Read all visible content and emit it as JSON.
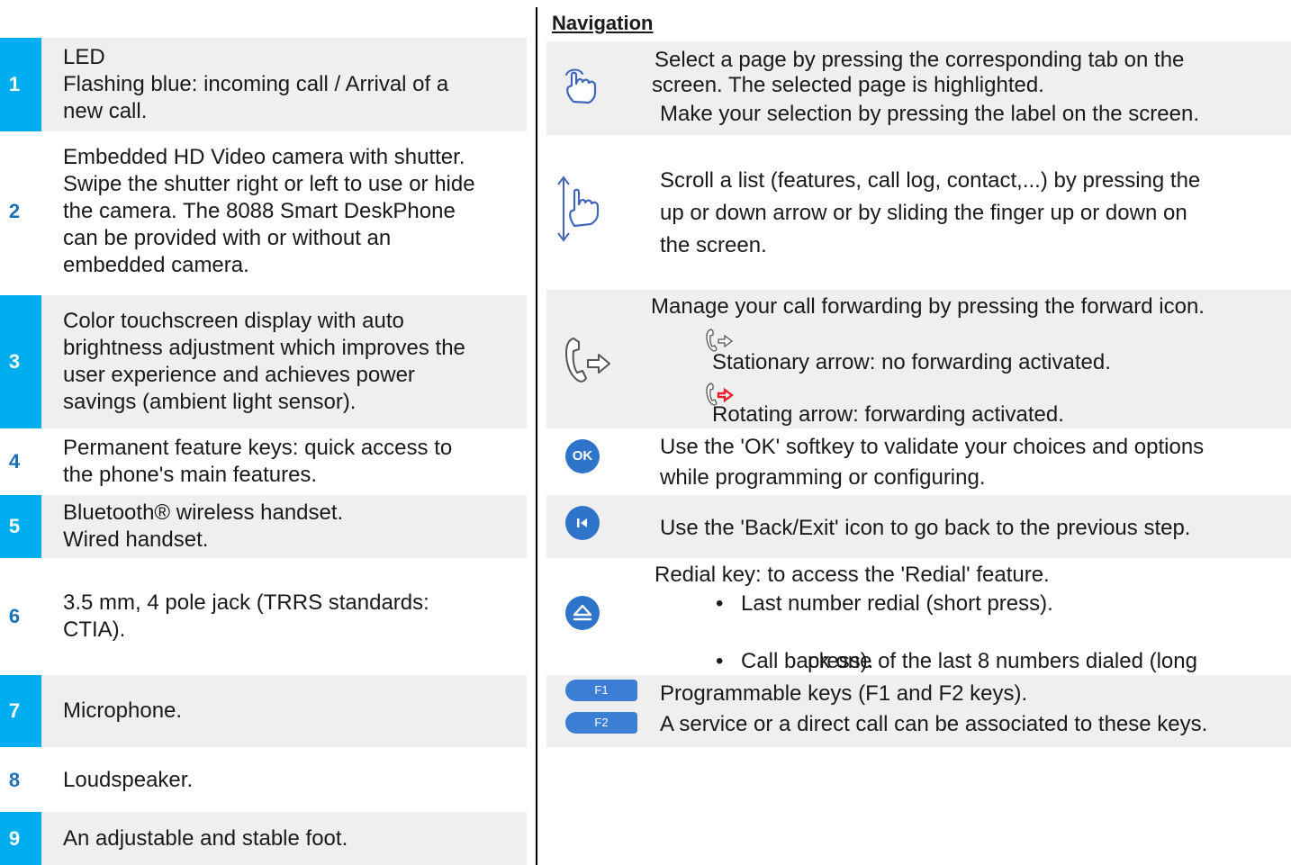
{
  "left_rows": [
    {
      "num": "1",
      "lines": [
        "LED",
        "Flashing blue: incoming call / Arrival of a",
        "new call."
      ]
    },
    {
      "num": "2",
      "lines": [
        "Embedded HD Video camera with shutter.",
        "Swipe the shutter right or left to use or hide",
        "the camera. The 8088 Smart DeskPhone",
        "can be provided with or without an",
        "embedded camera."
      ]
    },
    {
      "num": "3",
      "lines": [
        "Color touchscreen display with auto",
        "brightness adjustment which improves the",
        "user experience and achieves power",
        "savings (ambient light sensor)."
      ]
    },
    {
      "num": "4",
      "lines": [
        "Permanent feature keys: quick access to",
        "the phone's main features."
      ]
    },
    {
      "num": "5",
      "lines": [
        "Bluetooth® wireless handset.",
        "Wired handset."
      ]
    },
    {
      "num": "6",
      "lines": [
        "3.5 mm, 4 pole jack (TRRS standards:",
        "CTIA)."
      ]
    },
    {
      "num": "7",
      "lines": [
        "Microphone."
      ]
    },
    {
      "num": "8",
      "lines": [
        "Loudspeaker."
      ]
    },
    {
      "num": "9",
      "lines": [
        "An adjustable and stable foot."
      ]
    }
  ],
  "navigation": {
    "heading": "Navigation",
    "select": {
      "icon": "tap-hand-icon",
      "lines": [
        "Select a page by pressing the corresponding tab on the",
        "screen. The selected page is highlighted.",
        "Make your selection by pressing the label on the screen."
      ]
    },
    "scroll": {
      "icon": "scroll-hand-icon",
      "lines": [
        "Scroll a list (features, call log, contact,...) by pressing the",
        "up or down arrow or by sliding the finger up or down on",
        "the screen."
      ]
    },
    "forward": {
      "icon": "call-forward-icon",
      "intro": "Manage your call forwarding by pressing the forward icon.",
      "stationary": "Stationary arrow: no forwarding activated.",
      "rotating": "Rotating arrow: forwarding activated.",
      "active_color": "#e8202a"
    },
    "ok": {
      "icon_label": "OK",
      "lines": [
        "Use the 'OK' softkey to validate your choices and options",
        "while programming or configuring."
      ]
    },
    "back": {
      "icon": "back-exit-icon",
      "text": "Use the 'Back/Exit' icon to go back to the previous step."
    },
    "redial": {
      "icon": "redial-icon",
      "intro": "Redial key: to access the 'Redial' feature.",
      "bullet1": "Last number redial (short press).",
      "bullet2_line1": "Call back one of the last 8 numbers dialed (long",
      "bullet2_line2": "press)."
    },
    "fkeys": {
      "f1_label": "F1",
      "f2_label": "F2",
      "line1": "Programmable keys (F1 and F2 keys).",
      "line2": "A service or a direct call can be associated to these keys."
    }
  },
  "colors": {
    "accent_strip": "#00aeef",
    "number_blue": "#1b6fb8",
    "icon_blue": "#2e74c9",
    "shade": "#efefef"
  }
}
